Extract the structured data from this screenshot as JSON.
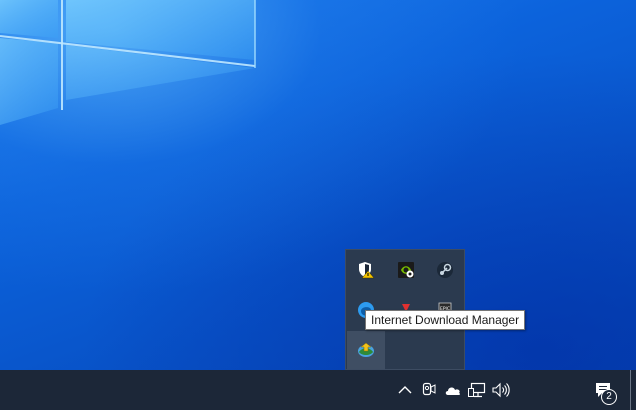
{
  "tooltip": {
    "text": "Internet Download Manager"
  },
  "tray_overflow": {
    "icons": [
      {
        "name": "windows-security-warning-icon"
      },
      {
        "name": "nvidia-geforce-icon"
      },
      {
        "name": "steam-icon"
      },
      {
        "name": "edge-icon"
      },
      {
        "name": "red-arrow-icon"
      },
      {
        "name": "epic-games-icon",
        "label": "EPIC"
      },
      {
        "name": "internet-download-manager-icon"
      }
    ]
  },
  "taskbar": {
    "notification_count": "2",
    "icons": [
      "chevron-up-icon",
      "meet-now-icon",
      "onedrive-cloud-icon",
      "network-icon",
      "volume-icon",
      "action-center-icon"
    ]
  },
  "colors": {
    "taskbar": "#1c2738",
    "tray_flyout": "#2b3a4f",
    "desktop_accent": "#0c63dc"
  }
}
